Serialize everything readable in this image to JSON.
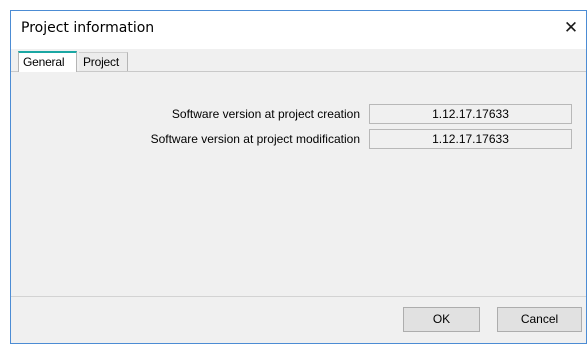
{
  "window": {
    "title": "Project information",
    "close_glyph": "✕"
  },
  "tabs": [
    {
      "label": "General",
      "active": true
    },
    {
      "label": "Project",
      "active": false
    }
  ],
  "fields": [
    {
      "label": "Software version at project creation",
      "value": "1.12.17.17633"
    },
    {
      "label": "Software version at project modification",
      "value": "1.12.17.17633"
    }
  ],
  "buttons": {
    "ok_label": "OK",
    "cancel_label": "Cancel"
  },
  "colors": {
    "window_border": "#4c8cd4",
    "active_tab_accent": "#1aa7a3",
    "dialog_background": "#f0f0f0"
  }
}
